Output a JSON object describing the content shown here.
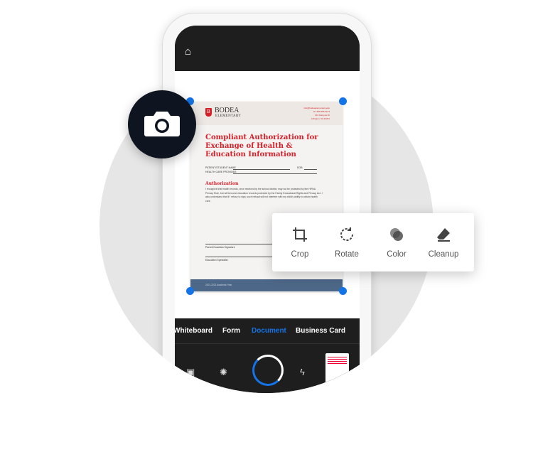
{
  "document": {
    "school_name": "BODEA",
    "school_sub": "ELEMENTARY",
    "logo_letter": "B",
    "contact_lines": [
      "info@bodeaelementary.edu",
      "tel: 555 555 0123",
      "123 Campus Dr",
      "Arlington, VA 22201"
    ],
    "title": "Compliant Authorization for Exchange of Health & Education Information",
    "field_patient": "PATIENT/STUDENT NAME",
    "field_dob": "DOB",
    "field_provider": "HEALTH CARE PROVIDER",
    "section_heading": "Authorization",
    "paragraph": "I recognize that health records, once received by the school district, may not be protected by the HIPAA Privacy Rule, but will become education records protected by the Family Educational Rights and Privacy Act. I also understand that if I refuse to sign, such refusal will not interfere with my child's ability to obtain health care.",
    "signature_label": "Parent/Guardian Signature",
    "specialist_label": "Education Specialist",
    "footer": "2021-2022 Academic Year"
  },
  "modes": [
    {
      "label": "Whiteboard"
    },
    {
      "label": "Form"
    },
    {
      "label": "Document",
      "active": true
    },
    {
      "label": "Business Card"
    }
  ],
  "tools": [
    {
      "label": "Crop",
      "icon": "crop-icon"
    },
    {
      "label": "Rotate",
      "icon": "rotate-icon"
    },
    {
      "label": "Color",
      "icon": "color-icon"
    },
    {
      "label": "Cleanup",
      "icon": "eraser-icon"
    }
  ],
  "colors": {
    "accent": "#1473e6",
    "doc_red": "#d71f28",
    "dark": "#1e1e1e"
  }
}
